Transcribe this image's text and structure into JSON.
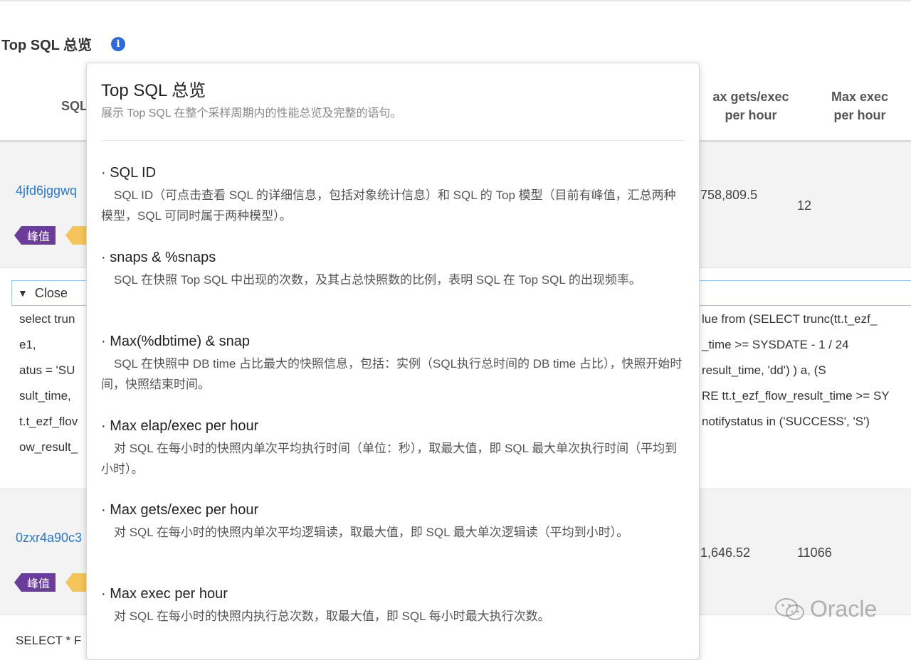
{
  "page": {
    "title": "Top SQL 总览"
  },
  "table": {
    "headers": {
      "sql": "SQL",
      "gets_line1": "ax gets/exec",
      "gets_line2": "per hour",
      "exec_line1": "Max exec",
      "exec_line2": "per hour"
    },
    "rows": [
      {
        "sql_id": "4jfd6jggwq",
        "peak_tag": "峰值",
        "gets": "758,809.5",
        "exec": "12"
      },
      {
        "sql_id": "0zxr4a90c3",
        "peak_tag": "峰值",
        "gets": "1,646.52",
        "exec": "11066"
      }
    ],
    "close_label": "Close",
    "sql_left_lines": [
      "select trun",
      "e1,",
      "atus = 'SU",
      "sult_time,",
      "t.t_ezf_flov",
      "ow_result_"
    ],
    "sql_right_lines": [
      "lue   from (SELECT trunc(tt.t_ezf_",
      "_time >= SYSDATE - 1 / 24",
      "result_time, 'dd')          ) a,        (S",
      "RE tt.t_ezf_flow_result_time >= SY",
      "notifystatus in ('SUCCESS', 'S')"
    ],
    "next_row_text": "SELECT * F"
  },
  "popover": {
    "title": "Top SQL 总览",
    "subtitle": "展示 Top SQL 在整个采样周期内的性能总览及完整的语句。",
    "items": [
      {
        "term": "· SQL ID",
        "desc": "SQL ID（可点击查看 SQL 的详细信息，包括对象统计信息）和 SQL 的 Top 模型（目前有峰值，汇总两种模型，SQL 可同时属于两种模型）。"
      },
      {
        "term": "· snaps & %snaps",
        "desc": "SQL 在快照 Top SQL 中出现的次数，及其占总快照数的比例，表明 SQL 在 Top SQL 的出现频率。"
      },
      {
        "term": "· Max(%dbtime) & snap",
        "desc": "SQL 在快照中 DB time 占比最大的快照信息，包括：实例（SQL执行总时间的 DB time 占比），快照开始时间，快照结束时间。"
      },
      {
        "term": "· Max elap/exec per hour",
        "desc": "对 SQL 在每小时的快照内单次平均执行时间（单位：秒），取最大值，即 SQL 最大单次执行时间（平均到小时）。"
      },
      {
        "term": "· Max gets/exec per hour",
        "desc": "对 SQL 在每小时的快照内单次平均逻辑读，取最大值，即 SQL 最大单次逻辑读（平均到小时）。"
      },
      {
        "term": "· Max exec per hour",
        "desc": "对 SQL 在每小时的快照内执行总次数，取最大值，即 SQL 每小时最大执行次数。"
      }
    ]
  },
  "watermark": {
    "text": "Oracle"
  },
  "colors": {
    "link": "#2f78c4",
    "peak_tag": "#6a3d9a",
    "sum_tag": "#f3c55b",
    "info_icon": "#2e6bd6"
  },
  "icons": {
    "info": "info-icon",
    "close_caret": "caret-down-icon",
    "watermark": "wechat-icon"
  }
}
